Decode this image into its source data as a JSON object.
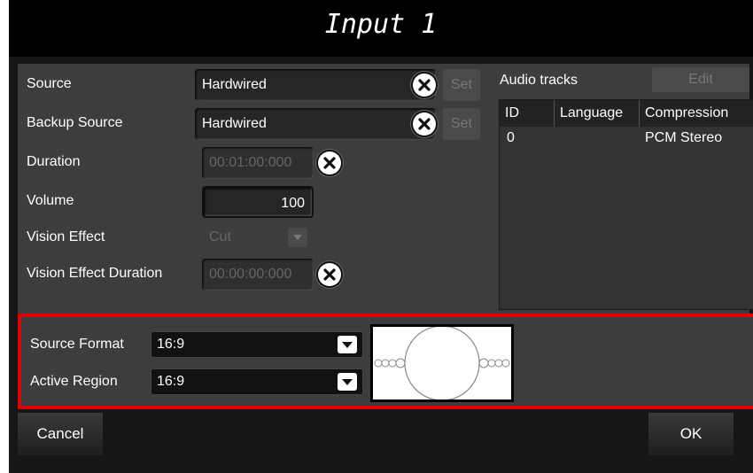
{
  "dialog": {
    "title": "Input 1"
  },
  "form": {
    "source": {
      "label": "Source",
      "value": "Hardwired",
      "set_label": "Set"
    },
    "backup_source": {
      "label": "Backup Source",
      "value": "Hardwired",
      "set_label": "Set"
    },
    "duration": {
      "label": "Duration",
      "value": "00:01:00:000"
    },
    "volume": {
      "label": "Volume",
      "value": "100"
    },
    "vision_effect": {
      "label": "Vision Effect",
      "value": "Cut"
    },
    "vision_effect_duration": {
      "label": "Vision Effect Duration",
      "value": "00:00:00:000"
    }
  },
  "audio_tracks": {
    "title": "Audio tracks",
    "edit_label": "Edit",
    "columns": [
      "ID",
      "Language",
      "Compression"
    ],
    "rows": [
      {
        "id": "0",
        "language": "",
        "compression": "PCM Stereo"
      }
    ]
  },
  "format": {
    "source_format": {
      "label": "Source Format",
      "value": "16:9"
    },
    "active_region": {
      "label": "Active Region",
      "value": "16:9"
    }
  },
  "footer": {
    "cancel_label": "Cancel",
    "ok_label": "OK"
  },
  "colors": {
    "highlight_border": "#e10000",
    "panel": "#3d3d3d",
    "titlebar": "#000000"
  },
  "icons": {
    "clear": "close-circle-icon",
    "dropdown": "chevron-down-icon"
  }
}
